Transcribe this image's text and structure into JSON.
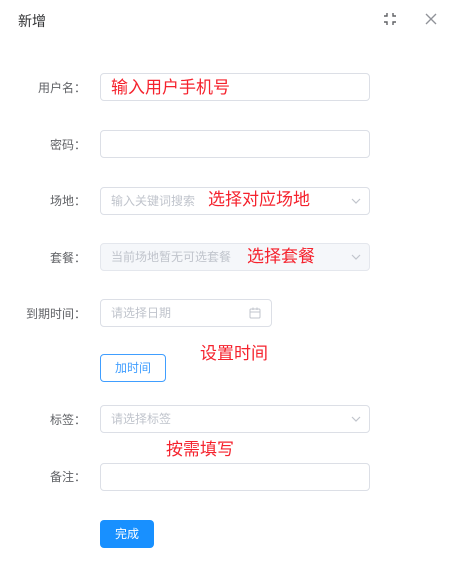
{
  "dialog": {
    "title": "新增",
    "expand_icon": "fullscreen-icon",
    "close_icon": "close-icon"
  },
  "form": {
    "username": {
      "label": "用户名：",
      "value": "",
      "placeholder": ""
    },
    "password": {
      "label": "密码：",
      "value": "",
      "placeholder": ""
    },
    "venue": {
      "label": "场地：",
      "placeholder": "输入关键词搜索"
    },
    "package": {
      "label": "套餐：",
      "placeholder": "当前场地暂无可选套餐"
    },
    "expiry": {
      "label": "到期时间：",
      "placeholder": "请选择日期"
    },
    "add_time_button": "加时间",
    "tags": {
      "label": "标签：",
      "placeholder": "请选择标签"
    },
    "remark": {
      "label": "备注：",
      "value": "",
      "placeholder": ""
    },
    "submit_button": "完成"
  },
  "annotations": {
    "username": "输入用户手机号",
    "venue": "选择对应场地",
    "package": "选择套餐",
    "expiry": "设置时间",
    "optional": "按需填写"
  },
  "colors": {
    "primary": "#1890ff",
    "annotation": "#f5222d",
    "border": "#dcdfe6"
  }
}
